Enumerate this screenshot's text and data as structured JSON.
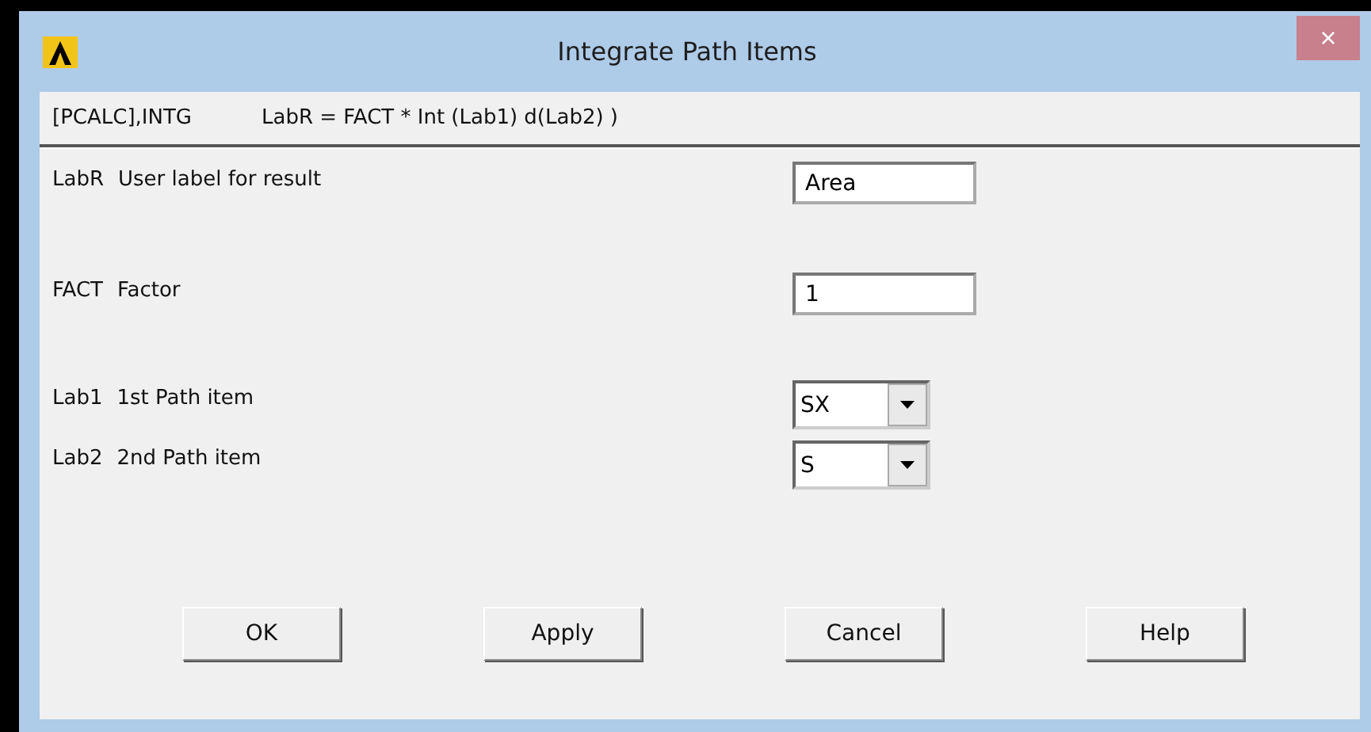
{
  "window": {
    "title": "Integrate Path Items",
    "close": "×"
  },
  "command": {
    "name": "[PCALC],INTG",
    "formula": "LabR = FACT * Int (Lab1) d(Lab2) )"
  },
  "rows": [
    {
      "kind": "text",
      "key": "LabR",
      "label": "User label for result",
      "value": "Area"
    },
    {
      "kind": "text",
      "key": "FACT",
      "label": "Factor",
      "value": "1"
    },
    {
      "kind": "select",
      "key": "Lab1",
      "label": "1st Path item",
      "value": "SX"
    },
    {
      "kind": "select",
      "key": "Lab2",
      "label": "2nd Path item",
      "value": "S"
    }
  ],
  "buttons": [
    "OK",
    "Apply",
    "Cancel",
    "Help"
  ]
}
